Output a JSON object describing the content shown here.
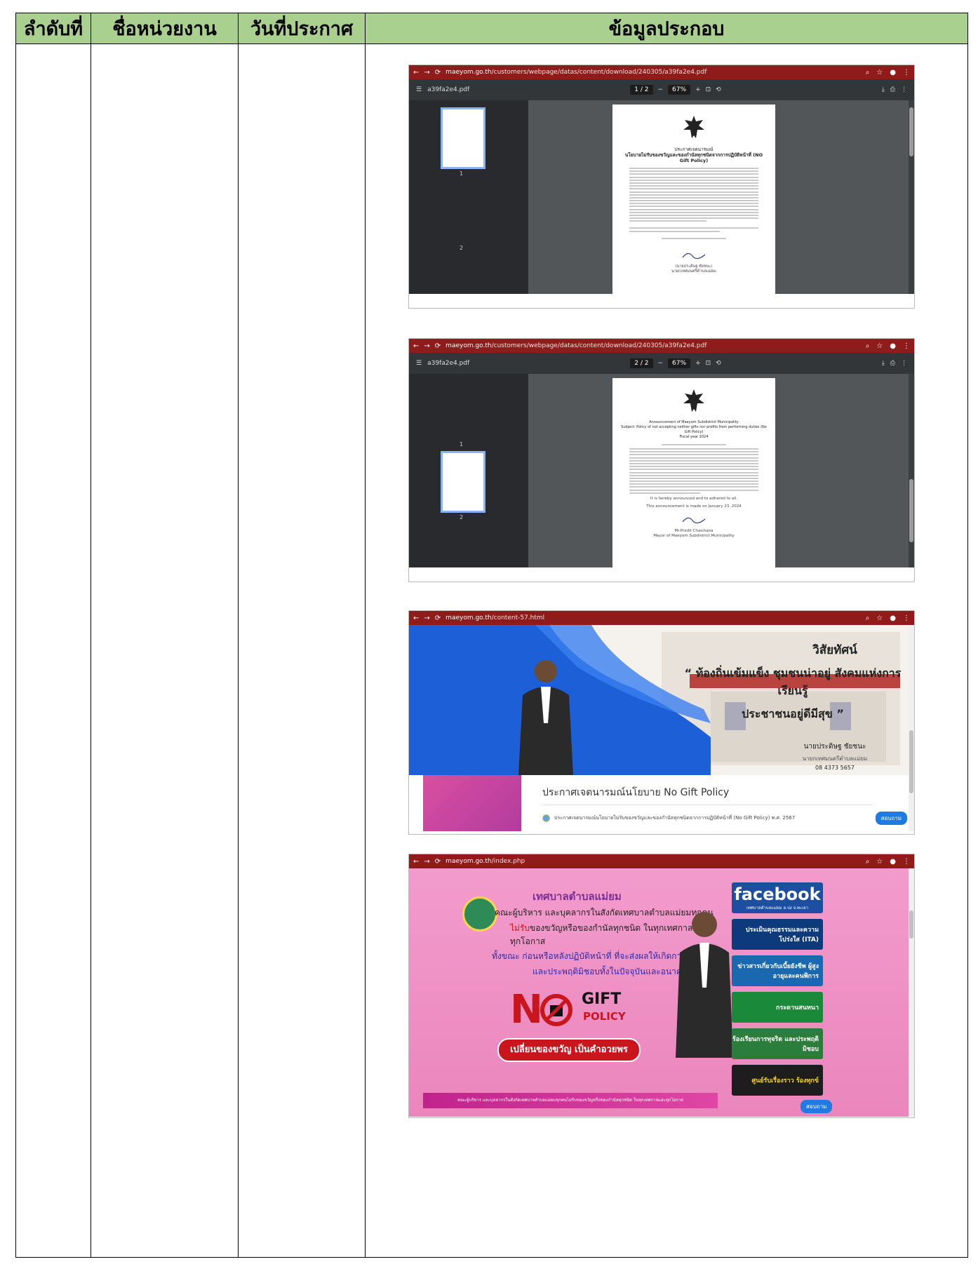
{
  "table": {
    "headers": [
      "ลำดับที่",
      "ชื่อหน่วยงาน",
      "วันที่ประกาศ",
      "ข้อมูลประกอบ"
    ]
  },
  "shots": [
    {
      "url_host": "maeyom.go.th",
      "url_path": "/customers/webpage/datas/content/download/240305/a39fa2e4.pdf",
      "filename": "a39fa2e4.pdf",
      "page_indicator": "1 / 2",
      "zoom": "67%",
      "thumb_labels": [
        "1",
        "2"
      ],
      "doc_title_1": "ประกาศเจตนารมณ์",
      "doc_title_2": "นโยบายไม่รับของขวัญและของกำนัลทุกชนิดจากการปฏิบัติหน้าที่ (NO Gift Policy)",
      "signature": "(นายประดิษฐ ชัยชนะ)",
      "signature_role": "นายกเทศมนตรีตำบลแม่ยม"
    },
    {
      "url_host": "maeyom.go.th",
      "url_path": "/customers/webpage/datas/content/download/240305/a39fa2e4.pdf",
      "filename": "a39fa2e4.pdf",
      "page_indicator": "2 / 2",
      "zoom": "67%",
      "thumb_labels": [
        "1",
        "2"
      ],
      "doc_title_1": "Announcement of Maeyom Subdistrict Municipality",
      "doc_title_2": "Subject: Policy of not accepting neither gifts nor profits from performing duties (No Gift Policy)",
      "doc_title_3": "Fiscal year 2024",
      "signature": "Mr.Pradit  Chaichana",
      "signature_role": "Mayor of Maeyom Subdistrict Municipality",
      "closing_1": "It is hereby announced and to adhered to all.",
      "closing_2": "This announcement is made on January 23, 2024"
    },
    {
      "url_host": "maeyom.go.th",
      "url_path": "/content-57.html",
      "vision_title": "วิสัยทัศน์",
      "vision_line1": "“ ท้องถิ่นเข้มแข็ง ชุมชนน่าอยู่ สังคมแห่งการเรียนรู้",
      "vision_line2": "ประชาชนอยู่ดีมีสุข ”",
      "mayor_name": "นายประดิษฐ ชัยชนะ",
      "mayor_role": "นายกเทศมนตรีตำบลแม่ยม",
      "phone": "08 4373 5657",
      "notice_heading": "ประกาศเจตนารมณ์นโยบาย No Gift Policy",
      "notice_item": "ประกาศเจตนารมณ์นโยบายไม่รับของขวัญและของกำนัลทุกชนิดจากการปฏิบัติหน้าที่ (No Gift Policy) พ.ศ. 2567",
      "ask_button": "สอบถาม"
    },
    {
      "url_host": "maeyom.go.th",
      "url_path": "/index.php",
      "municipality": "เทศบาลตำบลแม่ยม",
      "line1": "คณะผู้บริหาร และบุคลากรในสังกัดเทศบาลตำบลแม่ยมทุกคน",
      "line2_red": "ไม่รับ",
      "line2_rest": "ของขวัญหรือของกำนัลทุกชนิด ในทุกเทศกาลและทุกโอกาส",
      "line3": "ทั้งขณะ ก่อนหรือหลังปฏิบัติหน้าที่ ที่จะส่งผลให้เกิดการทุจริต",
      "line4": "และประพฤติมิชอบทั้งในปัจจุบันและอนาคต",
      "no_text": "N",
      "gift_text": "GIFT",
      "policy_text": "POLICY",
      "slogan": "เปลี่ยนของขวัญ เป็นคำอวยพร",
      "strip_text": "คณะผู้บริหาร และบุคลากรในสังกัดเทศบาลตำบลแม่ยมทุกคนไม่รับของขวัญหรือของกำนัลทุกชนิด ในทุกเทศกาลและทุกโอกาส",
      "side_facebook": "facebook",
      "side_facebook_sub": "เทศบาลตำบลแม่ยม อ.ปง จ.พะเยา",
      "side_ita": "ประเมินคุณธรรมและความโปร่งใส (ITA)",
      "side_news": "ข่าวสารเกี่ยวกับเบี้ยยังชีพ ผู้สูงอายุและคนพิการ",
      "side_qa": "กระดานสนทนา",
      "side_anti": "ร้องเรียนการทุจริต และประพฤติมิชอบ",
      "side_compl": "ศูนย์รับเรื่องราว ร้องทุกข์",
      "ask_button": "สอบถาม"
    }
  ],
  "colors": {
    "header_bg": "#a9d08e",
    "browser_bar": "#8f1b1b",
    "pdf_toolbar": "#323639"
  }
}
